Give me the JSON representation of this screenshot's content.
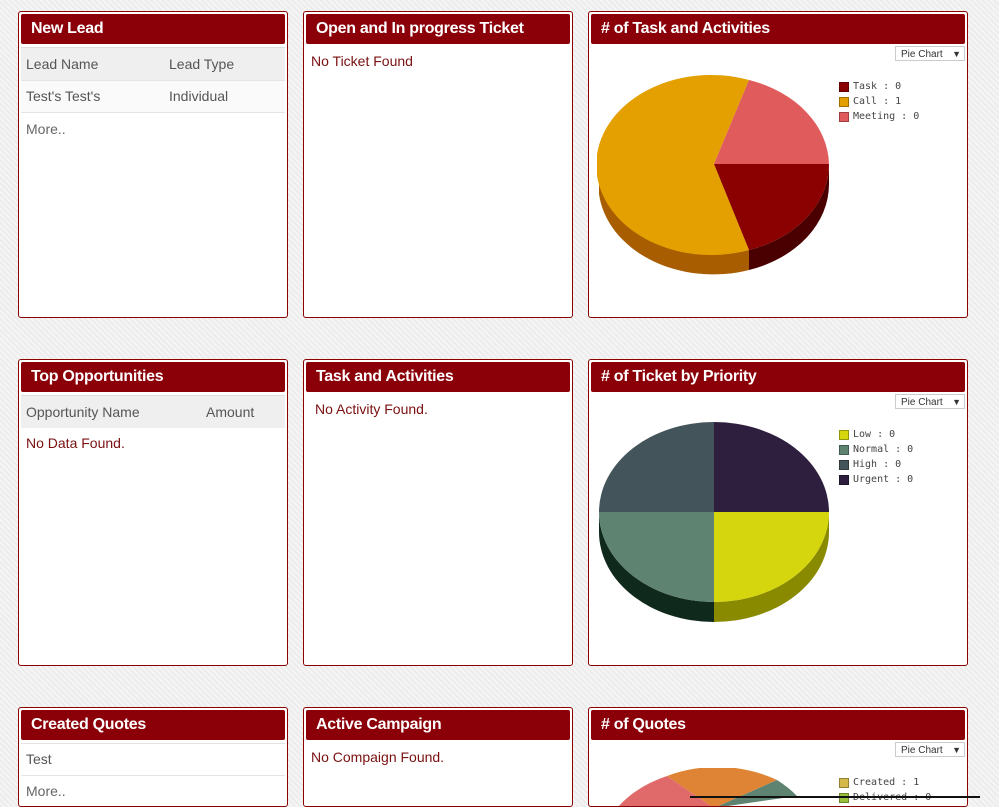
{
  "new_lead": {
    "title": "New Lead",
    "col1": "Lead Name",
    "col2": "Lead Type",
    "rows": [
      {
        "name": "Test's Test's",
        "type": "Individual"
      }
    ],
    "more": "More.."
  },
  "open_tickets": {
    "title": "Open and In progress Ticket",
    "message": "No Ticket Found"
  },
  "task_activities_chart": {
    "title": "# of Task and Activities",
    "select": "Pie Chart",
    "legend": [
      "Task : 0",
      "Call : 1",
      "Meeting : 0"
    ],
    "colors": {
      "task": "#8b0000",
      "call": "#e3a000",
      "meeting": "#e05b5b"
    }
  },
  "top_opportunities": {
    "title": "Top Opportunities",
    "col1": "Opportunity Name",
    "col2": "Amount",
    "message": "No Data Found."
  },
  "task_activities": {
    "title": "Task and Activities",
    "message": "No Activity Found."
  },
  "ticket_priority_chart": {
    "title": "# of Ticket by Priority",
    "select": "Pie Chart",
    "legend": [
      "Low : 0",
      "Normal : 0",
      "High : 0",
      "Urgent : 0"
    ],
    "colors": {
      "low": "#d6d60e",
      "normal": "#5e8370",
      "high": "#43545a",
      "urgent": "#2e1f3e"
    }
  },
  "created_quotes": {
    "title": "Created Quotes",
    "rows": [
      "Test"
    ],
    "more": "More.."
  },
  "active_campaign": {
    "title": "Active Campaign",
    "message": "No Compaign Found."
  },
  "quotes_chart": {
    "title": "# of Quotes",
    "select": "Pie Chart",
    "legend": [
      "Created : 1",
      "Delivered : 0"
    ],
    "colors": {
      "created": "#d4b84a",
      "delivered": "#9abf3a"
    }
  }
}
